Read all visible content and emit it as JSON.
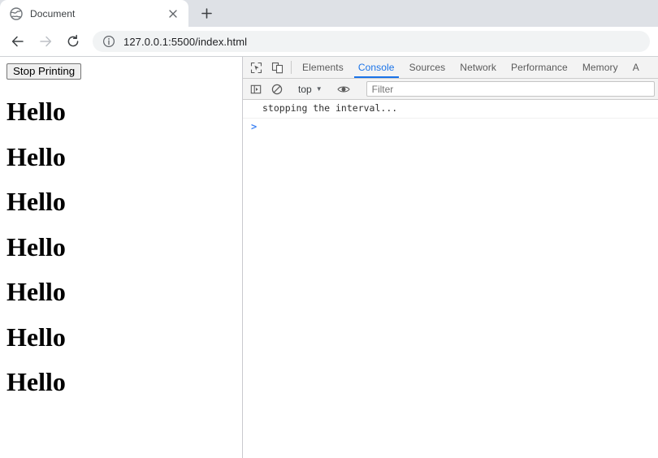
{
  "browser": {
    "tab": {
      "title": "Document",
      "favicon_icon": "globe-icon",
      "close_icon": "close-icon"
    },
    "newtab_icon": "plus-icon",
    "nav": {
      "back_icon": "arrow-left-icon",
      "forward_icon": "arrow-right-icon",
      "reload_icon": "reload-icon"
    },
    "omnibox": {
      "info_icon": "info-circle-icon",
      "url": "127.0.0.1:5500/index.html"
    }
  },
  "page": {
    "stop_button_label": "Stop Printing",
    "headings": [
      "Hello",
      "Hello",
      "Hello",
      "Hello",
      "Hello",
      "Hello",
      "Hello"
    ]
  },
  "devtools": {
    "inspect_icon": "inspect-element-icon",
    "device_icon": "device-toolbar-icon",
    "tabs": [
      {
        "label": "Elements",
        "active": false
      },
      {
        "label": "Console",
        "active": true
      },
      {
        "label": "Sources",
        "active": false
      },
      {
        "label": "Network",
        "active": false
      },
      {
        "label": "Performance",
        "active": false
      },
      {
        "label": "Memory",
        "active": false
      },
      {
        "label": "A",
        "active": false
      }
    ],
    "console_toolbar": {
      "sidebar_icon": "console-sidebar-icon",
      "clear_icon": "clear-console-icon",
      "context_label": "top",
      "context_caret_icon": "chevron-down-icon",
      "eye_icon": "eye-icon",
      "filter_placeholder": "Filter"
    },
    "console": {
      "messages": [
        "stopping the interval..."
      ],
      "prompt_symbol": ">"
    },
    "accent_color": "#1a73e8"
  }
}
